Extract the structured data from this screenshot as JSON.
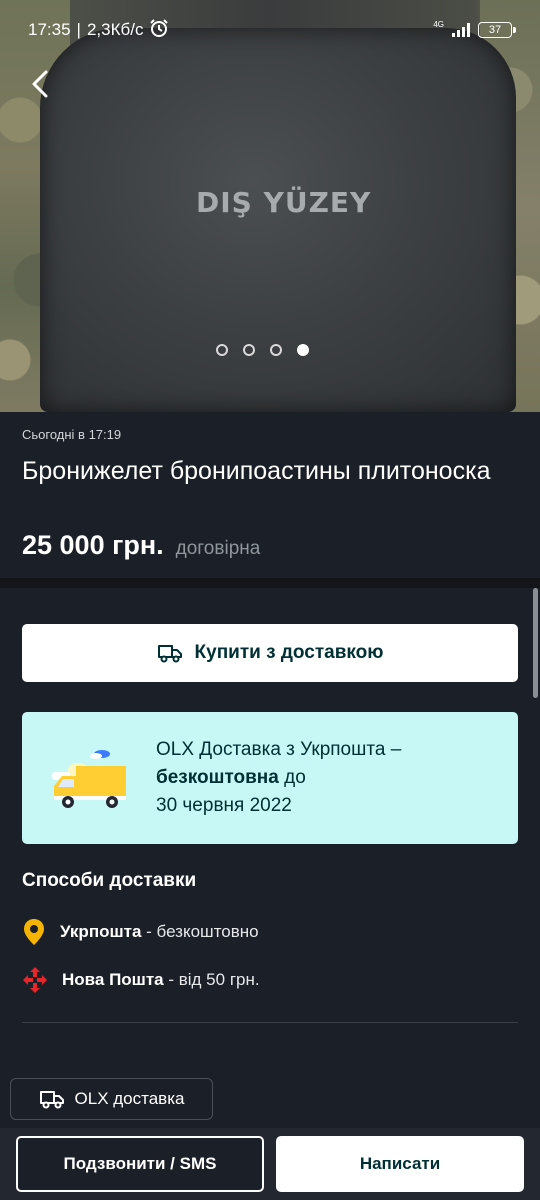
{
  "status_bar": {
    "time": "17:35",
    "separator": "|",
    "speed": "2,3Кб/с",
    "network": "4G",
    "battery": "37"
  },
  "gallery": {
    "photo_text": "DIŞ YÜZEY",
    "dots_total": 4,
    "active_dot": 4
  },
  "listing": {
    "date": "Сьогодні в 17:19",
    "title": "Бронижелет бронипоастины плитоноска",
    "price": "25 000 грн.",
    "negotiable": "договірна"
  },
  "buy": {
    "label": "Купити з доставкою"
  },
  "promo": {
    "line1": "OLX Доставка з Укрпошта –",
    "bold": "безкоштовна",
    "after_bold": " до",
    "line3": "30 червня 2022"
  },
  "delivery": {
    "title": "Способи доставки",
    "methods": [
      {
        "name": "Укрпошта",
        "price": " - безкоштовно",
        "icon": "ukrposhta-pin-icon"
      },
      {
        "name": "Нова Пошта",
        "price": " - від 50 грн.",
        "icon": "nova-poshta-icon"
      }
    ]
  },
  "chip": {
    "label": "OLX доставка"
  },
  "actions": {
    "call": "Подзвонити / SMS",
    "write": "Написати"
  },
  "colors": {
    "background": "#1b1f27",
    "promo_bg": "#c8f8f6",
    "brand_dark": "#002f34",
    "ukrposhta_yellow": "#f5b400",
    "nova_poshta_red": "#e8262a"
  }
}
